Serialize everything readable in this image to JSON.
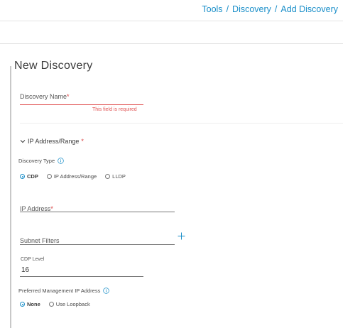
{
  "breadcrumb": {
    "items": [
      "Tools",
      "Discovery",
      "Add Discovery"
    ],
    "separator": "/"
  },
  "page": {
    "title": "New Discovery"
  },
  "discovery_name": {
    "label": "Discovery Name",
    "required_mark": "*",
    "error": "This field is required"
  },
  "ip_section": {
    "label": "IP Address/Range",
    "required_mark": "*"
  },
  "discovery_type": {
    "label": "Discovery Type",
    "options": [
      "CDP",
      "IP Address/Range",
      "LLDP"
    ],
    "selected": "CDP"
  },
  "ip_address": {
    "label": "IP Address",
    "required_mark": "*"
  },
  "subnet_filters": {
    "label": "Subnet Filters"
  },
  "cdp_level": {
    "label": "CDP Level",
    "value": "16"
  },
  "preferred_mgmt": {
    "label": "Preferred Management IP Address",
    "options": [
      "None",
      "Use Loopback"
    ],
    "selected": "None"
  },
  "colors": {
    "accent": "#1b8fc9",
    "error": "#e05353"
  }
}
